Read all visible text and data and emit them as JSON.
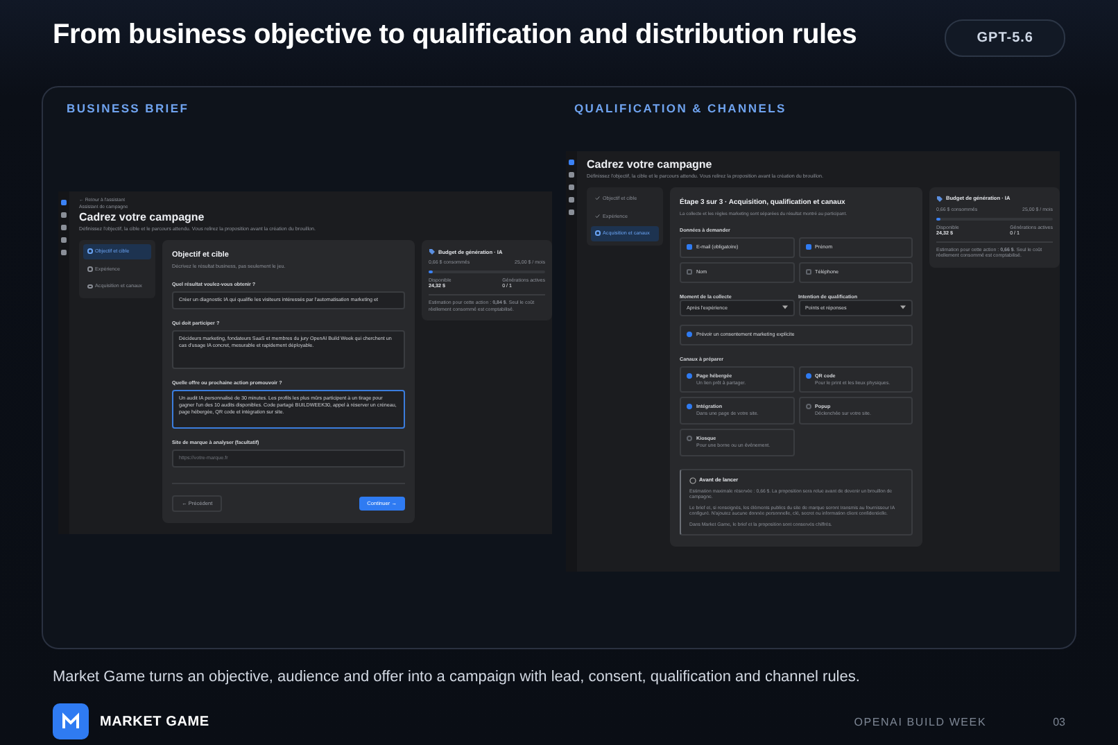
{
  "slide": {
    "title": "From business objective to qualification and distribution rules",
    "badge": "GPT-5.6"
  },
  "brief": {
    "label": "BUSINESS BRIEF",
    "screen": {
      "back": "← Retour à l'assistant",
      "crumb": "Assistant de campagne",
      "title": "Cadrez votre campagne",
      "description": "Définissez l'objectif, la cible et le parcours attendu. Vous relirez la proposition avant la création du brouillon.",
      "steps": [
        {
          "label": "Objectif et cible",
          "selected": true,
          "done": false
        },
        {
          "label": "Expérience",
          "selected": false,
          "done": false
        },
        {
          "label": "Acquisition et canaux",
          "selected": false,
          "done": false
        }
      ],
      "form": {
        "title": "Objectif et cible",
        "subtitle": "Décrivez le résultat business, pas seulement le jeu.",
        "fields": [
          {
            "kind": "input",
            "label": "Quel résultat voulez-vous obtenir ?",
            "value": "Créer un diagnostic IA qui qualifie les visiteurs intéressés par l'automatisation marketing et",
            "focused": false
          },
          {
            "kind": "textarea",
            "label": "Qui doit participer ?",
            "value": "Décideurs marketing, fondateurs SaaS et membres du jury OpenAI Build Week qui cherchent un cas d'usage IA concret, mesurable et rapidement déployable.",
            "focused": false
          },
          {
            "kind": "textarea",
            "label": "Quelle offre ou prochaine action promouvoir ?",
            "value": "Un audit IA personnalisé de 30 minutes. Les profils les plus mûrs participent à un tirage pour gagner l'un des 10 audits disponibles. Code partagé BUILDWEEK30, appel à réserver un créneau, page hébergée, QR code et intégration sur site.",
            "focused": true
          },
          {
            "kind": "input",
            "label": "Site de marque à analyser (facultatif)",
            "placeholder": "https://votre-marque.fr",
            "focused": false
          }
        ],
        "prev": "← Précédent",
        "next": "Continuer →"
      },
      "budget": {
        "title": "Budget de génération · IA",
        "consumed": "0,66 $ consommés",
        "limit": "25,00 $ / mois",
        "level": 0.03,
        "available_label": "Disponible",
        "available": "24,32 $",
        "active_label": "Générations actives",
        "active": "0 / 1",
        "note": "Estimation pour cette action : **0,84 $**. Seul le coût réellement consommé est comptabilisé."
      }
    }
  },
  "channels": {
    "label": "QUALIFICATION & CHANNELS",
    "screen": {
      "title": "Cadrez votre campagne",
      "description": "Définissez l'objectif, la cible et le parcours attendu. Vous relirez la proposition avant la création du brouillon.",
      "steps": [
        {
          "label": "Objectif et cible",
          "selected": false,
          "done": true
        },
        {
          "label": "Expérience",
          "selected": false,
          "done": true
        },
        {
          "label": "Acquisition et canaux",
          "selected": true,
          "done": false
        }
      ],
      "heading": "Étape 3 sur 3 · Acquisition, qualification et canaux",
      "subtitle": "La collecte et les règles marketing sont séparées du résultat montré au participant.",
      "data_label": "Données à demander",
      "data_fields": [
        {
          "label": "E-mail (obligatoire)",
          "checked": true
        },
        {
          "label": "Prénom",
          "checked": true
        },
        {
          "label": "Nom",
          "checked": false
        },
        {
          "label": "Téléphone",
          "checked": false
        }
      ],
      "selects": [
        {
          "label": "Moment de la collecte",
          "value": "Après l'expérience"
        },
        {
          "label": "Intention de qualification",
          "value": "Points et réponses"
        }
      ],
      "consent": {
        "label": "Prévoir un consentement marketing explicite",
        "checked": true
      },
      "channels_label": "Canaux à préparer",
      "channels": [
        {
          "label": "Page hébergée",
          "hint": "Un lien prêt à partager.",
          "checked": true
        },
        {
          "label": "QR code",
          "hint": "Pour le print et les lieux physiques.",
          "checked": true
        },
        {
          "label": "Intégration",
          "hint": "Dans une page de votre site.",
          "checked": true
        },
        {
          "label": "Popup",
          "hint": "Déclenchée sur votre site.",
          "checked": false
        },
        {
          "label": "Kiosque",
          "hint": "Pour une borne ou un événement.",
          "checked": false
        }
      ],
      "notice": {
        "title": "Avant de lancer",
        "paragraphs": [
          "Estimation maximale réservée : 0,66 $. La proposition sera relue avant de devenir un brouillon de campagne.",
          "Le brief et, si renseignés, les éléments publics du site de marque seront transmis au fournisseur IA configuré. N'ajoutez aucune donnée personnelle, clé, secret ou information client confidentielle.",
          "Dans Market Game, le brief et la proposition sont conservés chiffrés."
        ]
      },
      "budget": {
        "title": "Budget de génération · IA",
        "consumed": "0,66 $ consommés",
        "limit": "25,00 $ / mois",
        "level": 0.03,
        "available_label": "Disponible",
        "available": "24,32 $",
        "active_label": "Générations actives",
        "active": "0 / 1",
        "note": "Estimation pour cette action : **0,66 $**. Seul le coût réellement consommé est comptabilisé."
      }
    }
  },
  "caption": "Market Game turns an objective, audience and offer into a campaign with lead, consent, qualification and channel rules.",
  "footer": {
    "brand": "MARKET GAME",
    "event": "OPENAI BUILD WEEK",
    "page": "03"
  }
}
